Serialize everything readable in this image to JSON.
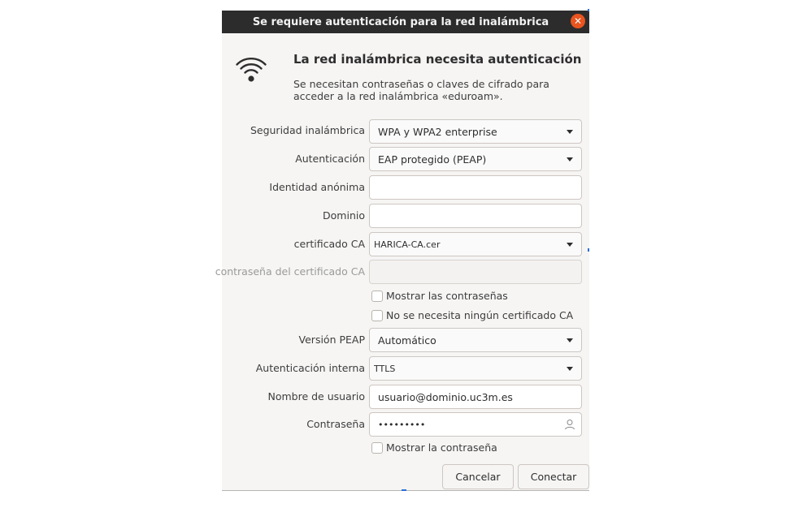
{
  "window": {
    "title": "Se requiere autenticación para la red inalámbrica",
    "close_glyph": "✕"
  },
  "header": {
    "icon": "wifi-icon",
    "title": "La red inalámbrica necesita autenticación",
    "description": "Se necesitan contraseñas o claves de cifrado para acceder a la red inalámbrica «eduroam»."
  },
  "form": {
    "wireless_security": {
      "label": "Seguridad inalámbrica",
      "value": "WPA y WPA2 enterprise"
    },
    "authentication": {
      "label": "Autenticación",
      "value": "EAP protegido (PEAP)"
    },
    "anonymous_identity": {
      "label": "Identidad anónima",
      "value": ""
    },
    "domain": {
      "label": "Dominio",
      "value": ""
    },
    "ca_certificate": {
      "label": "certificado CA",
      "value": "HARICA-CA.cer"
    },
    "ca_certificate_password": {
      "label": "contraseña del certificado CA",
      "value": ""
    },
    "show_passwords": {
      "label": "Mostrar las contraseñas",
      "checked": false
    },
    "no_ca_needed": {
      "label": "No se necesita ningún certificado CA",
      "checked": false
    },
    "peap_version": {
      "label": "Versión PEAP",
      "value": "Automático"
    },
    "inner_authentication": {
      "label": "Autenticación interna",
      "value": "TTLS"
    },
    "username": {
      "label": "Nombre de usuario",
      "value": "usuario@dominio.uc3m.es"
    },
    "password": {
      "label": "Contraseña",
      "value": "•••••••••"
    },
    "show_password": {
      "label": "Mostrar la contraseña",
      "checked": false
    }
  },
  "buttons": {
    "cancel": "Cancelar",
    "connect": "Conectar"
  },
  "colors": {
    "titlebar": "#2c2c2c",
    "close_button": "#e9541f",
    "dialog_bg": "#f6f5f4"
  }
}
